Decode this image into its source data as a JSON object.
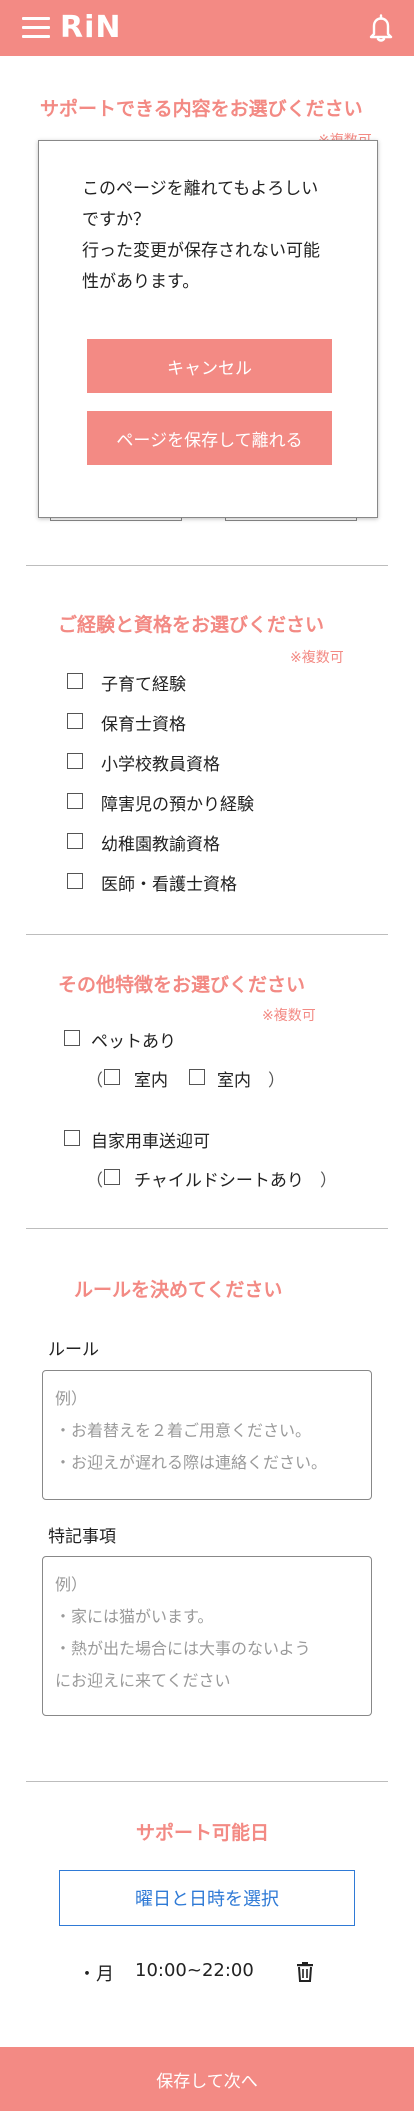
{
  "header": {
    "logo": "RiN"
  },
  "section_support": {
    "title": "サポートできる内容をお選びください",
    "note": "※複数可"
  },
  "dialog": {
    "message_lines": [
      "このページを離れてもよろしい",
      "ですか？",
      "行った変更が保存されない可能",
      "性があります。"
    ],
    "cancel_label": "キャンセル",
    "save_leave_label": "ページを保存して離れる"
  },
  "section_experience": {
    "title": "ご経験と資格をお選びください",
    "note": "※複数可",
    "items": [
      "子育て経験",
      "保育士資格",
      "小学校教員資格",
      "障害児の預かり経験",
      "幼稚園教諭資格",
      "医師・看護士資格"
    ]
  },
  "section_other": {
    "title": "その他特徴をお選びください",
    "note": "※複数可",
    "pet_label": "ペットあり",
    "pet_options": [
      "室内",
      "室内"
    ],
    "car_label": "自家用車送迎可",
    "car_option": "チャイルドシートあり",
    "paren_open": "（",
    "paren_close": "）"
  },
  "section_rules": {
    "title": "ルールを決めてください",
    "rule_label": "ルール",
    "rule_placeholder_lines": [
      "例）",
      "・お着替えを２着ご用意ください。",
      "・お迎えが遅れる際は連絡ください。"
    ],
    "notes_label": "特記事項",
    "notes_placeholder_lines": [
      "例）",
      "・家には猫がいます。",
      "・熱が出た場合には大事のないよう",
      "にお迎えに来てください"
    ]
  },
  "section_schedule": {
    "title": "サポート可能日",
    "select_label": "曜日と日時を選択",
    "slot_day": "・月",
    "slot_time": "10:00~22:00"
  },
  "footer": {
    "label": "保存して次へ"
  },
  "colors": {
    "accent": "#f38a84",
    "link_blue": "#2f7ad6"
  }
}
